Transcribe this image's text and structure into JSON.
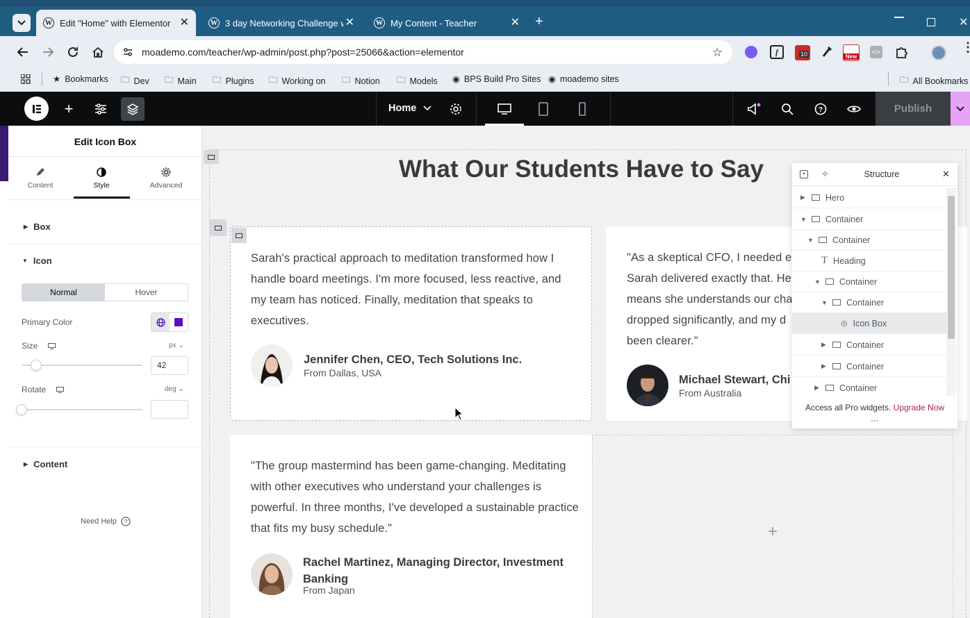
{
  "browser": {
    "tabs": [
      {
        "title": "Edit \"Home\" with Elementor",
        "active": true
      },
      {
        "title": "3 day Networking Challenge wi",
        "active": false
      },
      {
        "title": "My Content - Teacher",
        "active": false
      }
    ],
    "url": "moademo.com/teacher/wp-admin/post.php?post=25066&action=elementor",
    "bookmarks": [
      "Bookmarks",
      "Dev",
      "Main",
      "Plugins",
      "Working on",
      "Notion",
      "Models",
      "BPS Build Pro Sites",
      "moademo sites",
      "All Bookmarks"
    ],
    "badge_10": "10",
    "badge_new": "New"
  },
  "editor": {
    "page_name": "Home",
    "publish_label": "Publish"
  },
  "panel": {
    "title": "Edit Icon Box",
    "tabs": [
      "Content",
      "Style",
      "Advanced"
    ],
    "active_tab": "Style",
    "sections": {
      "box": "Box",
      "icon": "Icon",
      "content": "Content"
    },
    "state_toggle": [
      "Normal",
      "Hover"
    ],
    "primary_color_label": "Primary Color",
    "primary_color": "#5b0fbf",
    "size_label": "Size",
    "size_unit": "px",
    "size_value": "42",
    "rotate_label": "Rotate",
    "rotate_unit": "deg",
    "rotate_value": "",
    "need_help": "Need Help"
  },
  "canvas": {
    "heading": "What Our Students Have to Say",
    "testimonials": [
      {
        "quote": "Sarah's practical approach to meditation transformed how I handle board meetings. I'm more focused, less reactive, and my team has noticed. Finally, meditation that speaks to executives.",
        "name": "Jennifer Chen, CEO, Tech Solutions Inc.",
        "location": "From Dallas, USA"
      },
      {
        "quote": "\"As a skeptical CFO, I needed e Sarah delivered exactly that. He means she understands our cha dropped significantly, and my d been clearer.\"",
        "lines": [
          "\"As a skeptical CFO, I needed e",
          "Sarah delivered exactly that. He",
          "means she understands our cha",
          "dropped significantly, and my d",
          "been clearer.\""
        ],
        "name": "Michael Stewart, Chi",
        "location": "From Australia"
      },
      {
        "quote": "\"The group mastermind has been game-changing. Meditating with other executives who understand your challenges is powerful. In three months, I've developed a sustainable practice that fits my busy schedule.\"",
        "name": "Rachel Martinez, Managing Director, Investment Banking",
        "location": "From Japan"
      }
    ]
  },
  "structure": {
    "title": "Structure",
    "items": [
      {
        "label": "Hero",
        "expanded": false
      },
      {
        "label": "Container",
        "expanded": true
      },
      {
        "label": "Container",
        "expanded": true
      },
      {
        "label": "Heading",
        "expanded": null
      },
      {
        "label": "Container",
        "expanded": true
      },
      {
        "label": "Container",
        "expanded": true
      },
      {
        "label": "Icon Box",
        "expanded": null,
        "selected": true
      },
      {
        "label": "Container",
        "expanded": false
      },
      {
        "label": "Container",
        "expanded": false
      },
      {
        "label": "Container",
        "expanded": false
      }
    ],
    "promo_text": "Access all Pro widgets.",
    "promo_link": "Upgrade Now"
  }
}
